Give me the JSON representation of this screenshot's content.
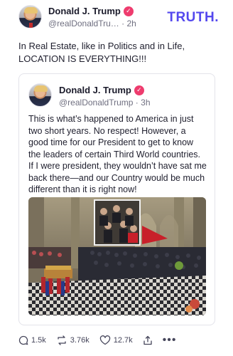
{
  "post": {
    "author_name": "Donald J. Trump",
    "handle": "@realDonaldTru…",
    "time": "2h",
    "text": "In Real Estate, like in Politics and in Life, LOCATION IS EVERYTHING!!!"
  },
  "brand": {
    "logo_text": "TRUTH."
  },
  "quoted": {
    "author_name": "Donald J. Trump",
    "handle": "@realDonaldTrump",
    "time": "3h",
    "text": "This is what’s happened to America in just two short years. No respect! However, a good time for our President to get to know the leaders of certain Third World countries. If I were president, they wouldn’t have sat me back there—and our Country would be much different than it is right now!"
  },
  "actions": {
    "replies": "1.5k",
    "retruths": "3.76k",
    "likes": "12.7k"
  },
  "colors": {
    "brand": "#5448ee",
    "verified": "#ee3c6e"
  },
  "icons": [
    "verified-badge-icon",
    "reply-icon",
    "retruth-icon",
    "like-icon",
    "share-icon",
    "more-icon"
  ]
}
